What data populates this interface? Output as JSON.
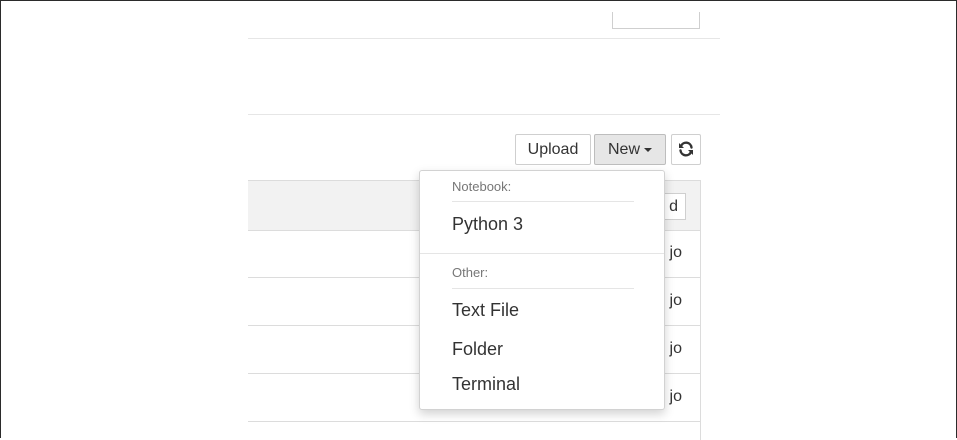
{
  "toolbar": {
    "upload_label": "Upload",
    "new_label": "New",
    "refresh_icon": "refresh-icon"
  },
  "list": {
    "header_button_label": "d",
    "rows": [
      {
        "modified": "jo"
      },
      {
        "modified": "jo"
      },
      {
        "modified": "jo"
      },
      {
        "modified": "jo"
      }
    ]
  },
  "new_menu": {
    "notebook_header": "Notebook:",
    "python_label": "Python 3",
    "other_header": "Other:",
    "text_file_label": "Text File",
    "folder_label": "Folder",
    "terminal_label": "Terminal"
  }
}
